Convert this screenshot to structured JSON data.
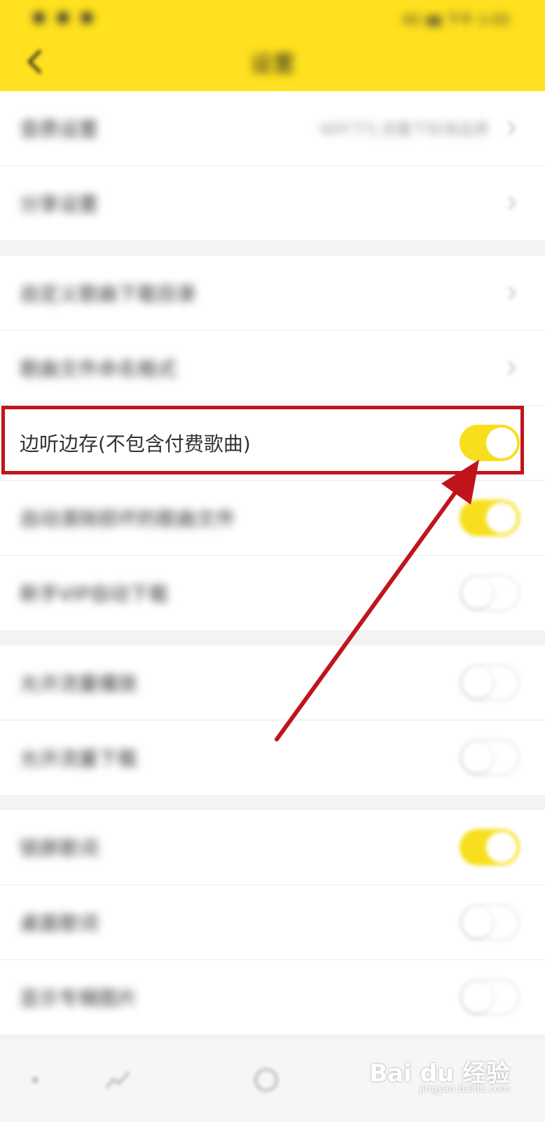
{
  "status_bar": {
    "left": "● ● ●",
    "right": "4G ▮▮ 下午 1:05"
  },
  "header": {
    "title": "设置"
  },
  "groups": [
    [
      {
        "label": "音质设置",
        "value": "WiFi下5,流量下标准品质",
        "control": "chevron"
      },
      {
        "label": "分享设置",
        "value": "",
        "control": "chevron"
      }
    ],
    [
      {
        "label": "自定义歌曲下载目录",
        "value": "",
        "control": "chevron"
      },
      {
        "label": "歌曲文件命名格式",
        "value": "",
        "control": "chevron"
      },
      {
        "label": "边听边存(不包含付费歌曲)",
        "value": "",
        "control": "toggle",
        "on": true,
        "highlighted": true
      },
      {
        "label": "自动清除损坏的歌曲文件",
        "value": "",
        "control": "toggle",
        "on": true
      },
      {
        "label": "新手VIP自动下载",
        "value": "",
        "control": "toggle",
        "on": false
      }
    ],
    [
      {
        "label": "允许流量播放",
        "value": "",
        "control": "toggle",
        "on": false
      },
      {
        "label": "允许流量下载",
        "value": "",
        "control": "toggle",
        "on": false
      }
    ],
    [
      {
        "label": "锁屏歌词",
        "value": "",
        "control": "toggle",
        "on": true
      },
      {
        "label": "桌面歌词",
        "value": "",
        "control": "toggle",
        "on": false
      },
      {
        "label": "显示专辑图片",
        "value": "",
        "control": "toggle",
        "on": false
      }
    ]
  ],
  "watermark": {
    "brand": "Bai du 经验",
    "sub": "jingyan.baidu.com"
  },
  "colors": {
    "accent": "#ffe11f",
    "toggle_on": "#f7df1e",
    "annotation": "#c0141c"
  },
  "icons": [
    "back-icon",
    "chevron-right-icon",
    "home-icon",
    "trend-icon",
    "circle-icon"
  ]
}
